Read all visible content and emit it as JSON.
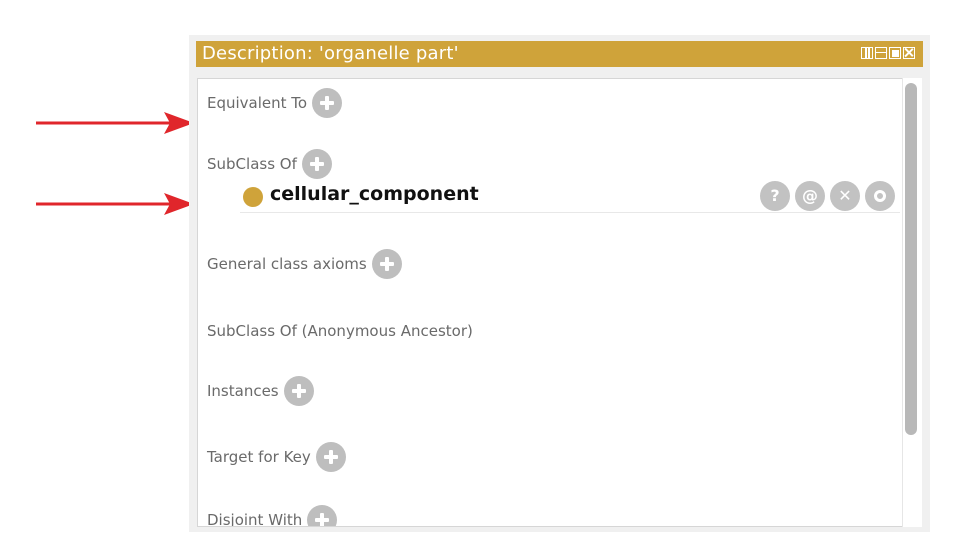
{
  "panel": {
    "title": "Description: 'organelle part'",
    "accent_color": "#cfa33a",
    "window_controls": [
      "columns-icon",
      "rows-icon",
      "maximize-icon",
      "close-icon"
    ]
  },
  "sections": [
    {
      "label": "Equivalent To",
      "has_add": true
    },
    {
      "label": "SubClass Of",
      "has_add": true
    },
    {
      "label": "General class axioms",
      "has_add": true
    },
    {
      "label": "SubClass Of (Anonymous Ancestor)",
      "has_add": false
    },
    {
      "label": "Instances",
      "has_add": true
    },
    {
      "label": "Target for Key",
      "has_add": true
    },
    {
      "label": "Disjoint With",
      "has_add": true
    }
  ],
  "subclass_entry": {
    "label": "cellular_component",
    "dot_color": "#cfa33a",
    "actions": [
      {
        "icon": "help-icon",
        "glyph": "?"
      },
      {
        "icon": "annotate-icon",
        "glyph": "@"
      },
      {
        "icon": "delete-icon",
        "glyph": "✕"
      },
      {
        "icon": "edit-icon",
        "glyph": ""
      }
    ]
  },
  "arrows": {
    "color": "#e0262b",
    "count": 2
  }
}
